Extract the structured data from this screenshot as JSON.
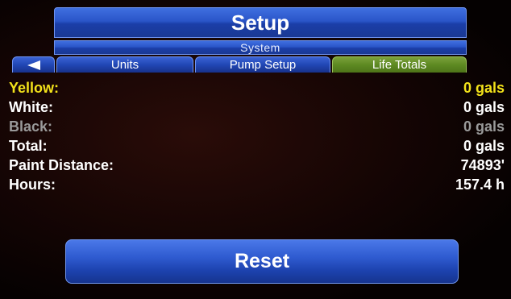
{
  "header": {
    "title": "Setup",
    "subtitle": "System"
  },
  "tabs": [
    {
      "label": "Units"
    },
    {
      "label": "Pump Setup"
    },
    {
      "label": "Life Totals",
      "active": true
    }
  ],
  "totals": [
    {
      "label": "Yellow:",
      "value": "0 gals",
      "color": "#f2e21a"
    },
    {
      "label": "White:",
      "value": "0 gals",
      "color": "#ffffff"
    },
    {
      "label": "Black:",
      "value": "0 gals",
      "color": "#9a9a9a"
    },
    {
      "label": "Total:",
      "value": "0 gals",
      "color": "#ffffff"
    },
    {
      "label": "Paint Distance:",
      "value": "74893'",
      "color": "#ffffff"
    },
    {
      "label": "Hours:",
      "value": "157.4 h",
      "color": "#ffffff"
    }
  ],
  "actions": {
    "reset_label": "Reset"
  },
  "icons": {
    "back": "back-arrow-icon"
  },
  "colors": {
    "accent_blue": "#2a55c8",
    "active_tab_green": "#5e8a22"
  }
}
